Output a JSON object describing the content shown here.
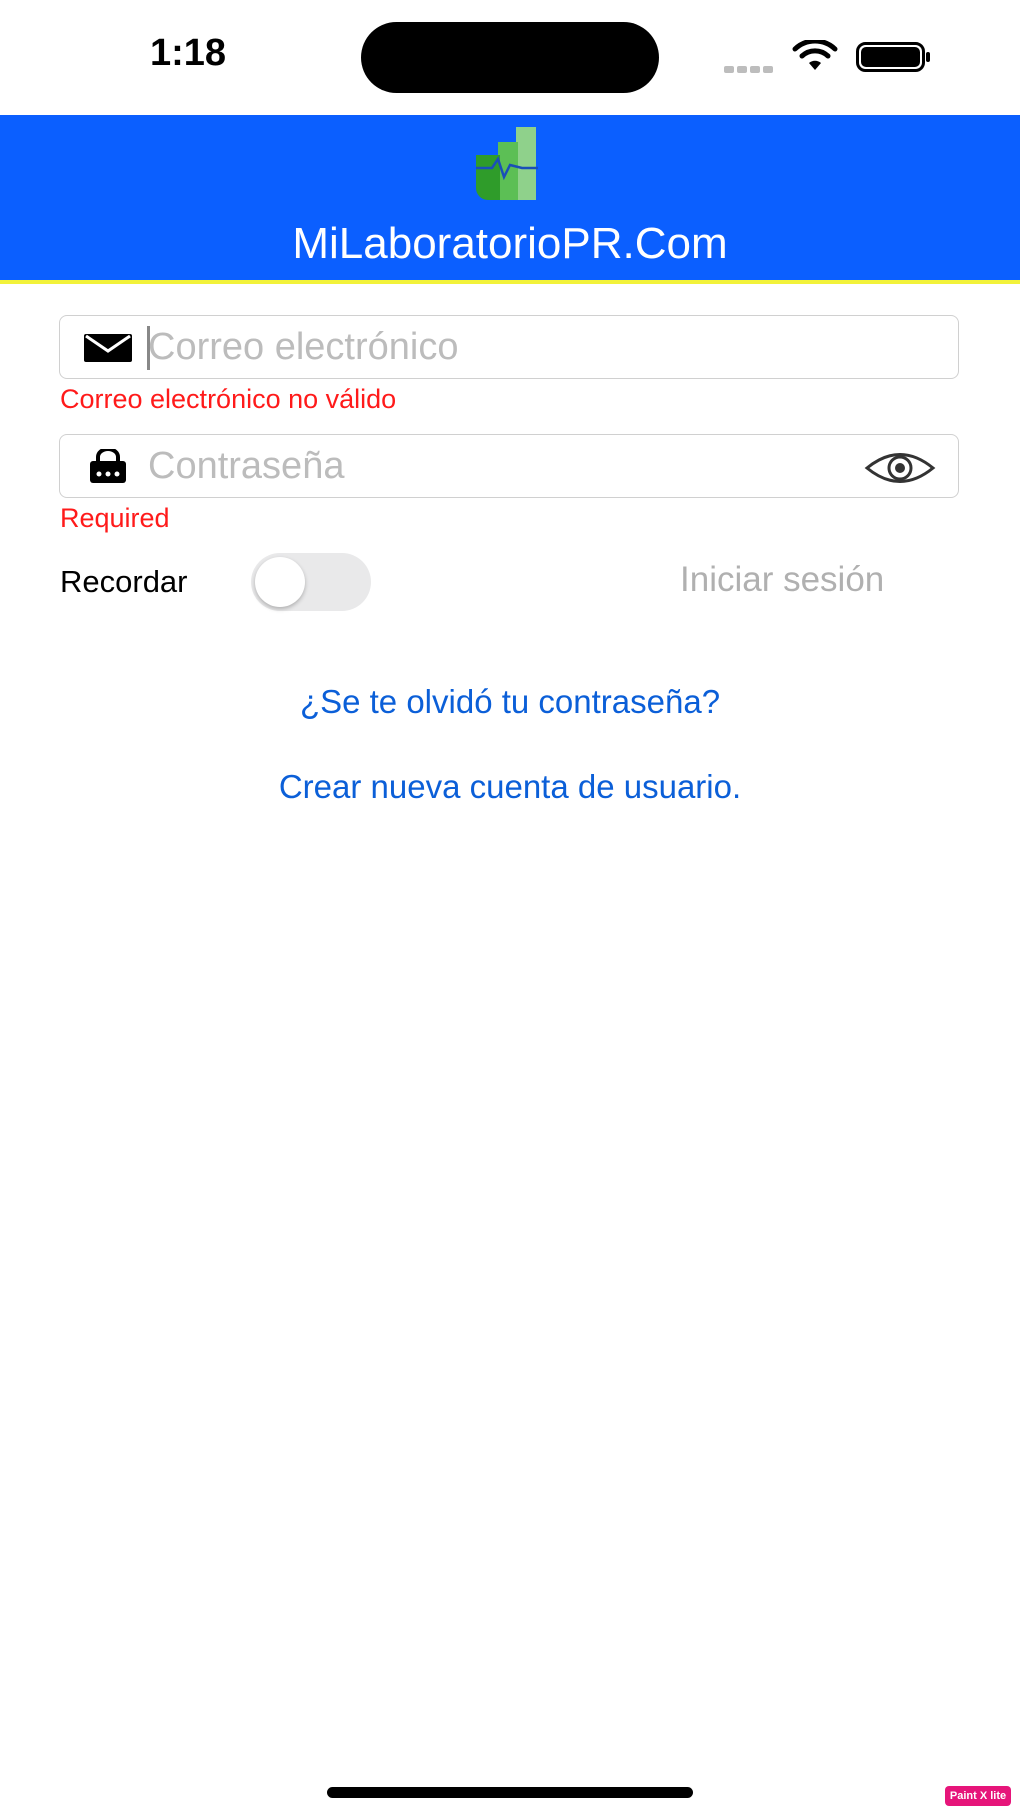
{
  "status_bar": {
    "time": "1:18"
  },
  "header": {
    "title": "MiLaboratorioPR.Com"
  },
  "email": {
    "placeholder": "Correo electrónico",
    "value": "",
    "error": "Correo electrónico no válido"
  },
  "password": {
    "placeholder": "Contraseña",
    "value": "",
    "error": "Required"
  },
  "remember": {
    "label": "Recordar",
    "on": false
  },
  "login_button": {
    "label": "Iniciar sesión"
  },
  "links": {
    "forgot": "¿Se te olvidó tu contraseña?",
    "create": "Crear nueva cuenta de usuario."
  },
  "watermark": "Paint X lite",
  "colors": {
    "header_bg": "#0b5fff",
    "header_stripe": "#f2f23a",
    "error": "#ff1a1a",
    "link": "#0b5fd8",
    "disabled_text": "#b0b0b0"
  },
  "icons": {
    "email": "envelope-icon",
    "password": "lock-icon",
    "visibility": "eye-icon",
    "logo": "lab-logo"
  }
}
